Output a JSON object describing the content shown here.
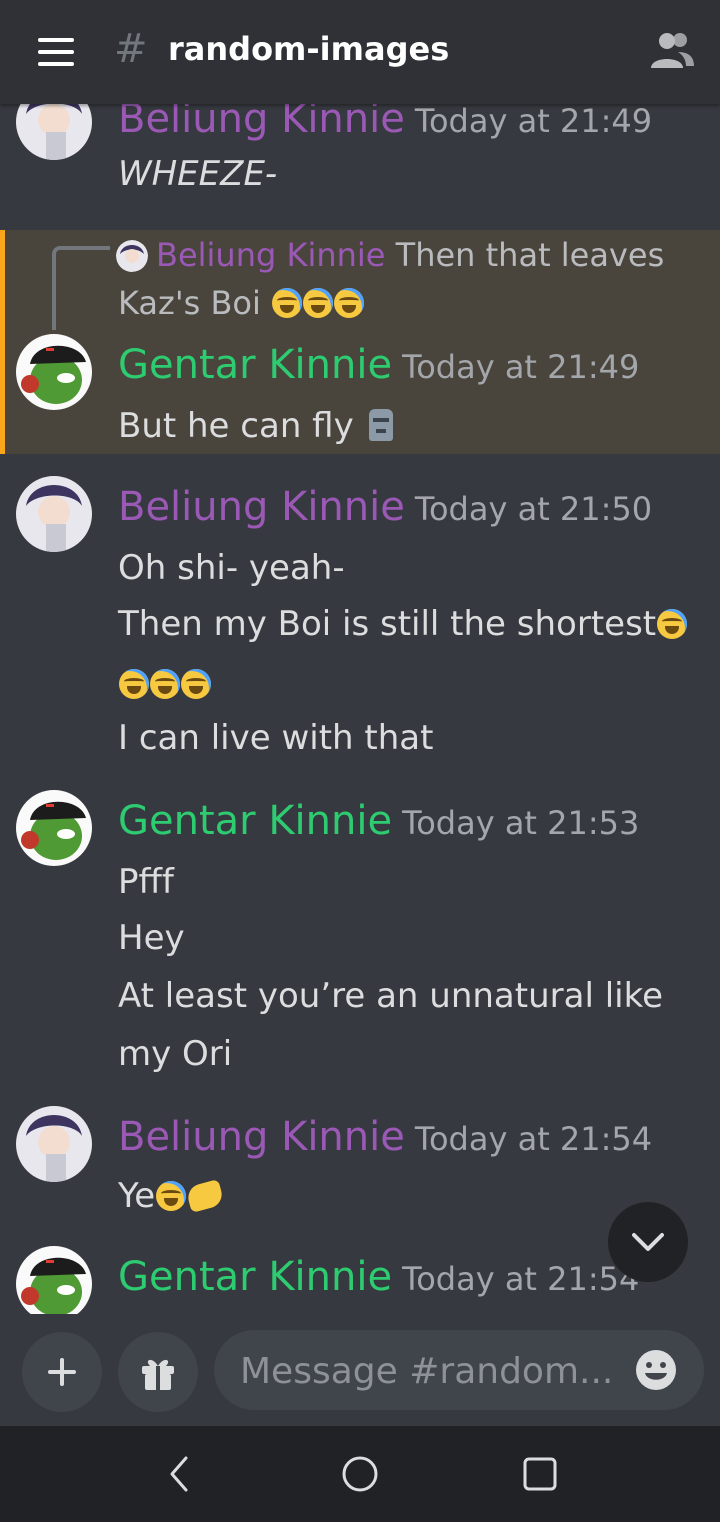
{
  "header": {
    "channel_hash": "#",
    "channel_name": "random-images"
  },
  "messages": [
    {
      "author": "Beliung Kinnie",
      "timestamp": "Today at 21:49",
      "lines": [
        "WHEEZE-"
      ]
    },
    {
      "reply": {
        "author": "Beliung Kinnie",
        "text_line1": "Then that leaves",
        "text_line2": "Kaz's Boi"
      },
      "author": "Gentar Kinnie",
      "timestamp": "Today at 21:49",
      "lines": [
        "But he can fly"
      ]
    },
    {
      "author": "Beliung Kinnie",
      "timestamp": "Today at 21:50",
      "lines": [
        "Oh shi- yeah-",
        "Then my Boi is still the shortest",
        "",
        "I can live with that"
      ]
    },
    {
      "author": "Gentar Kinnie",
      "timestamp": "Today at 21:53",
      "lines": [
        "Pfff",
        "Hey",
        "At least you’re an unnatural like",
        "my Ori"
      ]
    },
    {
      "author": "Beliung Kinnie",
      "timestamp": "Today at 21:54",
      "lines": [
        "Ye"
      ]
    },
    {
      "author": "Gentar Kinnie",
      "timestamp": "Today at 21:54",
      "lines": []
    }
  ],
  "composer": {
    "placeholder": "Message #random..."
  },
  "colors": {
    "beliung": "#9b59b6",
    "gentar": "#2ecc71",
    "highlight": "#49443c",
    "mention_bar": "#faa61a"
  },
  "icons": [
    "menu-icon",
    "members-icon",
    "scroll-down-icon",
    "plus-icon",
    "gift-icon",
    "emoji-picker-icon",
    "back-icon",
    "home-icon",
    "recents-icon",
    "moai-emoji",
    "joy-emoji",
    "sob-emoji",
    "handshake-emoji"
  ]
}
